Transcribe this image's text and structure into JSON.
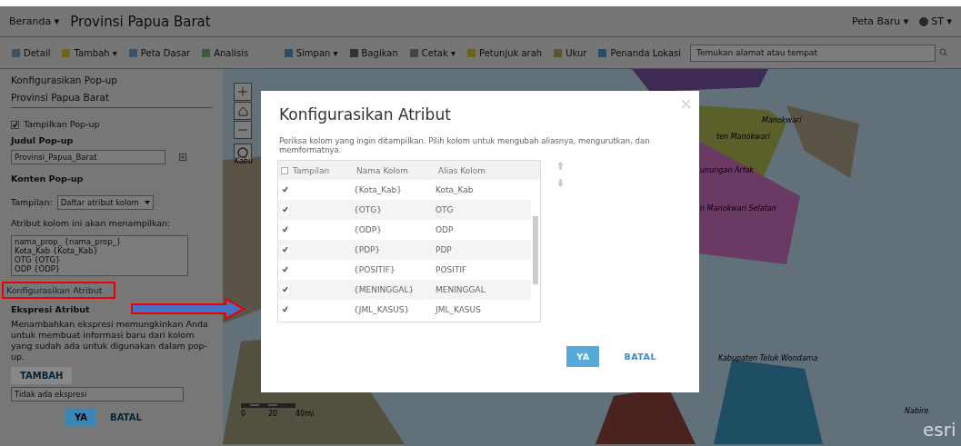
{
  "header": {
    "home_menu": "Beranda ▾",
    "map_title": "Provinsi Papua Barat",
    "new_map": "Peta Baru ▾",
    "user": "ST ▾"
  },
  "toolbar": {
    "left": [
      {
        "label": "Detail"
      },
      {
        "label": "Tambah ▾"
      },
      {
        "label": "Peta Dasar"
      },
      {
        "label": "Analisis"
      }
    ],
    "right": [
      {
        "label": "Simpan ▾"
      },
      {
        "label": "Bagikan"
      },
      {
        "label": "Cetak ▾"
      },
      {
        "label": "Petunjuk arah"
      },
      {
        "label": "Ukur"
      },
      {
        "label": "Penanda Lokasi"
      }
    ],
    "search": {
      "placeholder": "Temukan alamat atau tempat"
    }
  },
  "sidebar": {
    "title": "Konfigurasikan Pop-up",
    "layer": "Provinsi Papua Barat",
    "show_popup": {
      "label": "Tampilkan Pop-up",
      "checked": true
    },
    "title_label": "Judul Pop-up",
    "title_value": "Provinsi_Papua_Barat",
    "content_label": "Konten Pop-up",
    "display_label": "Tampilan:",
    "display_value": "Daftar atribut kolom",
    "fields_label": "Atribut kolom ini akan menampilkan:",
    "fields": [
      "nama_prop_ {nama_prop_}",
      "Kota_Kab {Kota_Kab}",
      "OTG {OTG}",
      "ODP {ODP}"
    ],
    "configure_link": "Konfigurasikan Atribut",
    "expr_label": "Ekspresi Atribut",
    "expr_text": "Menambahkan ekspresi memungkinkan Anda untuk membuat informasi baru dari kolom yang sudah ada untuk digunakan dalam pop-up.",
    "add_button": "TAMBAH",
    "expr_list": "Tidak ada ekspresi",
    "ok": "YA",
    "cancel": "BATAL"
  },
  "map": {
    "labels": [
      "Manokwari",
      "ten Manokwari",
      "unungan Arfak",
      "n Manokwari Selatan",
      "Kabupaten Teluk Wondama",
      "Nabire",
      "Kabu"
    ],
    "scale": [
      "0",
      "20",
      "40mi"
    ],
    "logo": "esri"
  },
  "dialog": {
    "title": "Konfigurasikan Atribut",
    "description": "Periksa kolom yang ingin ditampilkan. Pilih kolom untuk mengubah aliasnya, mengurutkan, dan memformatnya.",
    "columns": [
      {
        "label": "Tampilan",
        "checked": false
      },
      {
        "label": "Nama Kolom"
      },
      {
        "label": "Alias Kolom"
      }
    ],
    "rows": [
      {
        "field": "{Kota_Kab}",
        "alias": "Kota_Kab",
        "checked": true
      },
      {
        "field": "{OTG}",
        "alias": "OTG",
        "checked": true
      },
      {
        "field": "{ODP}",
        "alias": "ODP",
        "checked": true
      },
      {
        "field": "{PDP}",
        "alias": "PDP",
        "checked": true
      },
      {
        "field": "{POSITIF}",
        "alias": "POSITIF",
        "checked": true
      },
      {
        "field": "{MENINGGAL}",
        "alias": "MENINGGAL",
        "checked": true
      },
      {
        "field": "{JML_KASUS}",
        "alias": "JML_KASUS",
        "checked": true
      }
    ],
    "ok": "YA",
    "cancel": "BATAL"
  }
}
